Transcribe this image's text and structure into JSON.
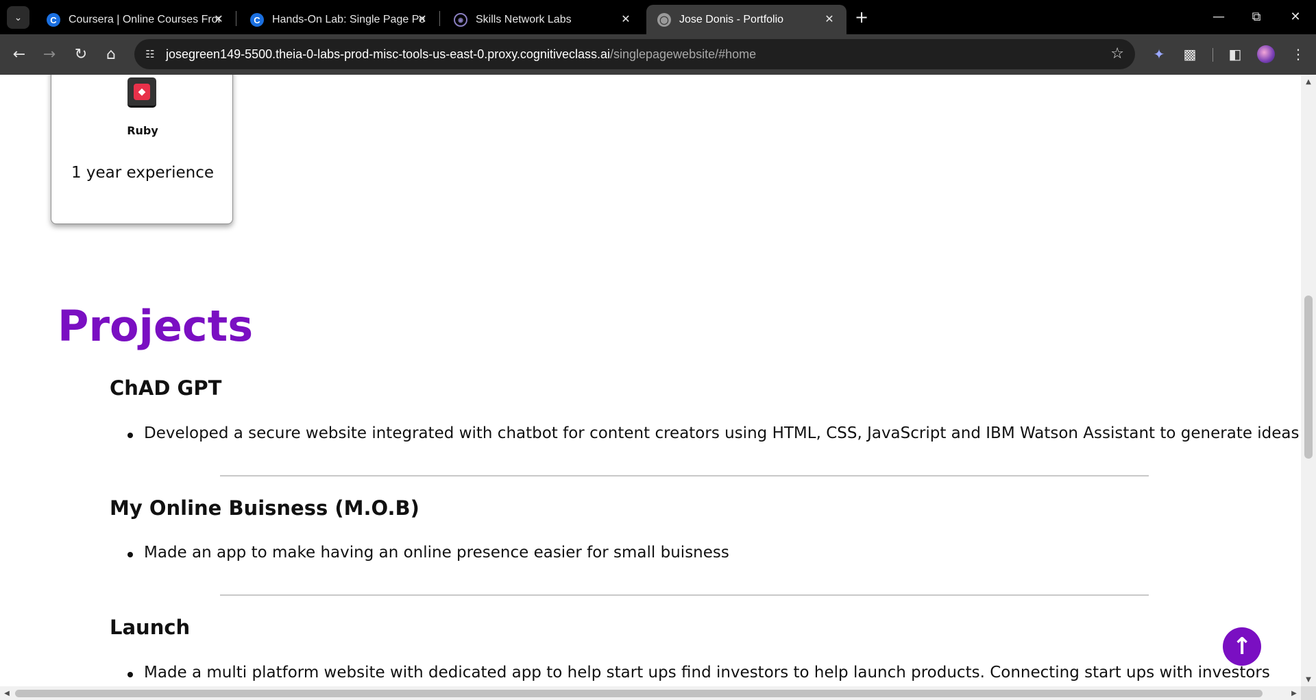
{
  "browser": {
    "tabs": [
      {
        "title": "Coursera | Online Courses From",
        "favicon": "coursera-icon",
        "active": false
      },
      {
        "title": "Hands-On Lab: Single Page Port",
        "favicon": "coursera-icon",
        "active": false
      },
      {
        "title": "Skills Network Labs",
        "favicon": "skills-network-icon",
        "active": false
      },
      {
        "title": "Jose Donis - Portfolio",
        "favicon": "globe-icon",
        "active": true
      }
    ],
    "address_bar": {
      "host": "josegreen149-5500.theia-0-labs-prod-misc-tools-us-east-0.proxy.cognitiveclass.ai",
      "path": "/singlepagewebsite/#home"
    }
  },
  "page": {
    "skill_card": {
      "name": "Ruby",
      "experience": "1 year experience",
      "icon": "ruby-icon"
    },
    "projects_section": {
      "title": "Projects",
      "items": [
        {
          "title": "ChAD GPT",
          "description": "Developed a secure website integrated with chatbot for content creators using HTML, CSS, JavaScript and IBM Watson Assistant to generate ideas"
        },
        {
          "title": "My Online Buisness (M.O.B)",
          "description": "Made an app to make having an online presence easier for small buisness"
        },
        {
          "title": "Launch",
          "description": "Made a multi platform website with dedicated app to help start ups find investors to help launch products. Connecting start ups with investors"
        }
      ]
    },
    "back_to_top_icon": "arrow-up-icon"
  },
  "colors": {
    "accent_purple": "#7a0fc2",
    "chrome_dark": "#3c3c3c",
    "tabbar_black": "#000000"
  }
}
